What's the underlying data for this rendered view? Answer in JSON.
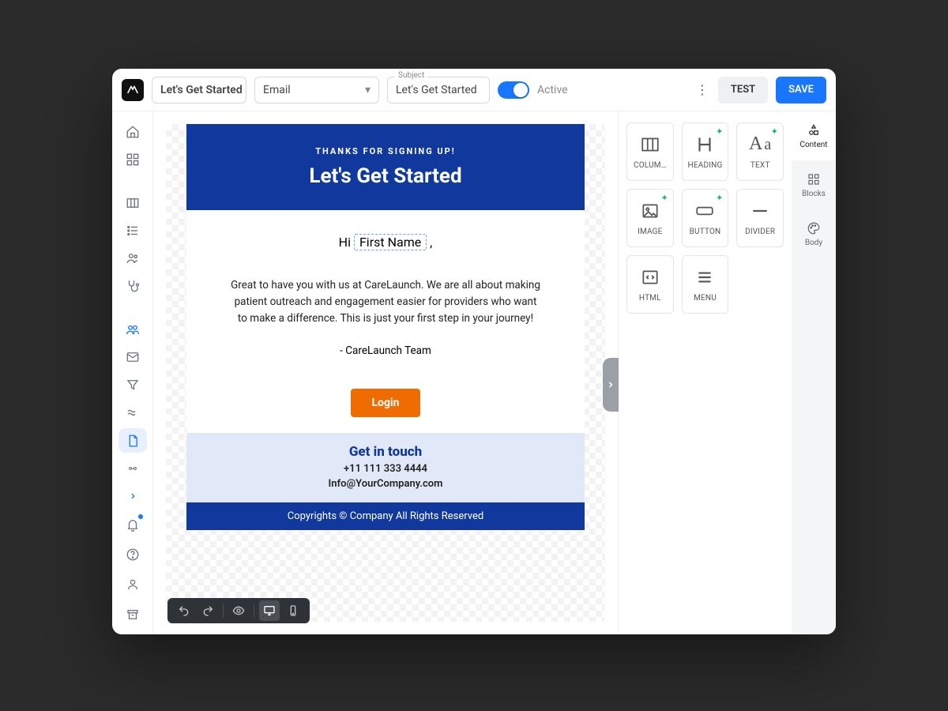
{
  "toolbar": {
    "doc_title": "Let's Get Started",
    "channel": "Email",
    "subject_field_label": "Subject",
    "subject": "Let's Get Started",
    "active_label": "Active",
    "active_on": true,
    "test_label": "TEST",
    "save_label": "SAVE"
  },
  "left_rail": {
    "items": [
      {
        "name": "home-icon"
      },
      {
        "name": "dashboard-icon"
      },
      {
        "name": "layout-icon"
      },
      {
        "name": "list-icon"
      },
      {
        "name": "people-icon"
      },
      {
        "name": "stethoscope-icon"
      },
      {
        "name": "team-icon",
        "active": true
      },
      {
        "name": "mail-icon"
      },
      {
        "name": "filter-icon"
      },
      {
        "name": "approx-icon"
      },
      {
        "name": "page-icon",
        "active": true
      },
      {
        "name": "link-icon"
      },
      {
        "name": "chevron-right-icon"
      }
    ],
    "bottom": [
      {
        "name": "bell-icon"
      },
      {
        "name": "help-icon"
      },
      {
        "name": "user-icon"
      },
      {
        "name": "archive-icon"
      }
    ]
  },
  "email_preview": {
    "kicker": "THANKS FOR SIGNING UP!",
    "title": "Let's Get Started",
    "greeting_prefix": "Hi",
    "merge_field": "First Name",
    "greeting_suffix": ",",
    "paragraph": "Great to have you with us at CareLaunch. We are all about making patient outreach and engagement easier for providers who want to make a difference. This is just your first step in your journey!",
    "signoff": "- CareLaunch Team",
    "cta": "Login",
    "footer_heading": "Get in touch",
    "footer_phone": "+11 111 333 4444",
    "footer_email": "Info@YourCompany.com",
    "copyright": "Copyrights © Company All Rights Reserved"
  },
  "preview_toolbar": {
    "items": [
      "undo",
      "redo",
      "preview",
      "desktop",
      "mobile"
    ],
    "active": "desktop"
  },
  "inspector": {
    "tabs": [
      {
        "id": "content",
        "label": "Content",
        "active": true
      },
      {
        "id": "blocks",
        "label": "Blocks"
      },
      {
        "id": "body",
        "label": "Body"
      }
    ],
    "blocks": [
      {
        "id": "columns",
        "label": "COLUM…",
        "ai": false
      },
      {
        "id": "heading",
        "label": "HEADING",
        "ai": true
      },
      {
        "id": "text",
        "label": "TEXT",
        "ai": true
      },
      {
        "id": "image",
        "label": "IMAGE",
        "ai": true
      },
      {
        "id": "button",
        "label": "BUTTON",
        "ai": true
      },
      {
        "id": "divider",
        "label": "DIVIDER",
        "ai": false
      },
      {
        "id": "html",
        "label": "HTML",
        "ai": false
      },
      {
        "id": "menu",
        "label": "MENU",
        "ai": false
      }
    ]
  }
}
